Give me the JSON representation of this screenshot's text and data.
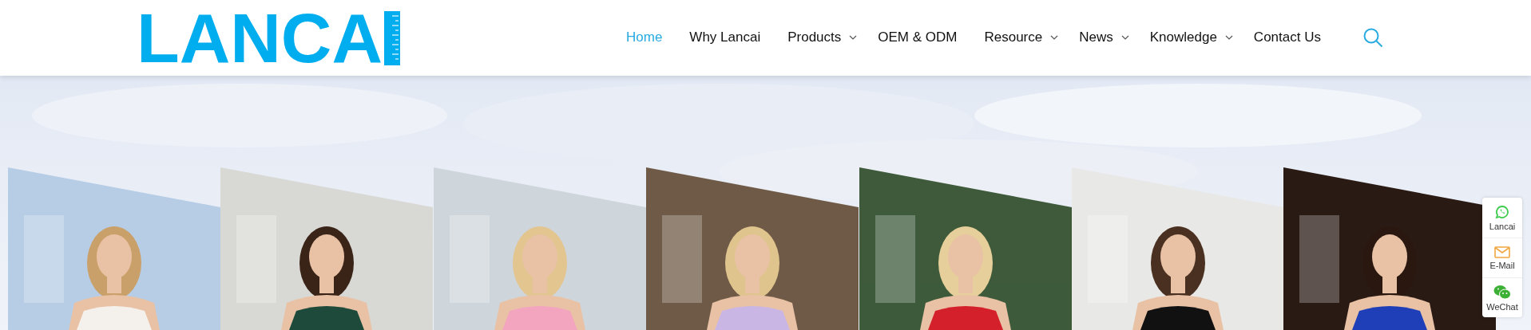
{
  "header": {
    "logo": "LANCA",
    "nav": [
      {
        "label": "Home",
        "selected": true,
        "dropdown": false
      },
      {
        "label": "Why Lancai",
        "selected": false,
        "dropdown": false
      },
      {
        "label": "Products",
        "selected": false,
        "dropdown": true
      },
      {
        "label": "OEM & ODM",
        "selected": false,
        "dropdown": false
      },
      {
        "label": "Resource",
        "selected": false,
        "dropdown": true
      },
      {
        "label": "News",
        "selected": false,
        "dropdown": true
      },
      {
        "label": "Knowledge",
        "selected": false,
        "dropdown": true
      },
      {
        "label": "Contact Us",
        "selected": false,
        "dropdown": false
      }
    ]
  },
  "contact_widget": [
    {
      "kind": "whatsapp",
      "label": "Lancai"
    },
    {
      "kind": "email",
      "label": "E-Mail"
    },
    {
      "kind": "wechat",
      "label": "WeChat"
    }
  ]
}
